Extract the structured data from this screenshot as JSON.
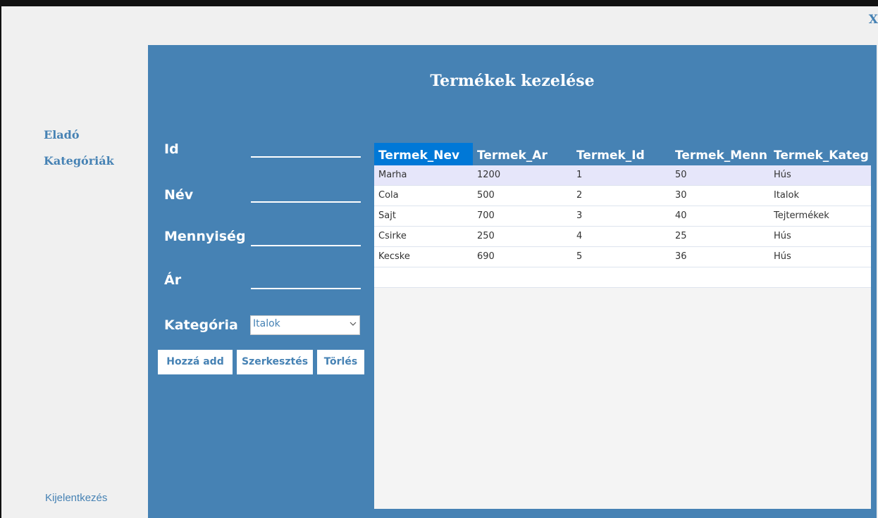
{
  "window": {
    "close_label": "X"
  },
  "sidebar": {
    "items": [
      {
        "label": "Eladó"
      },
      {
        "label": "Kategóriák"
      }
    ],
    "logout_label": "Kijelentkezés"
  },
  "main": {
    "title": "Termékek kezelése",
    "form": {
      "id_label": "Id",
      "name_label": "Név",
      "quantity_label": "Mennyiség",
      "price_label": "Ár",
      "category_label": "Kategória",
      "category_selected": "Italok"
    },
    "buttons": {
      "add": "Hozzá add",
      "edit": "Szerkesztés",
      "delete": "Törlés"
    },
    "table": {
      "columns": [
        "Termek_Nev",
        "Termek_Ar",
        "Termek_Id",
        "Termek_Menn",
        "Termek_Kateg"
      ],
      "rows": [
        [
          "Marha",
          "1200",
          "1",
          "50",
          "Hús"
        ],
        [
          "Cola",
          "500",
          "2",
          "30",
          "Italok"
        ],
        [
          "Sajt",
          "700",
          "3",
          "40",
          "Tejtermékek"
        ],
        [
          "Csirke",
          "250",
          "4",
          "25",
          "Hús"
        ],
        [
          "Kecske",
          "690",
          "5",
          "36",
          "Hús"
        ]
      ]
    }
  },
  "colors": {
    "accent": "#4682b4",
    "header_active": "#0078d7",
    "selected_row": "#e6e6fa"
  },
  "icons": {
    "close": "close-icon",
    "dropdown": "chevron-down-icon"
  }
}
